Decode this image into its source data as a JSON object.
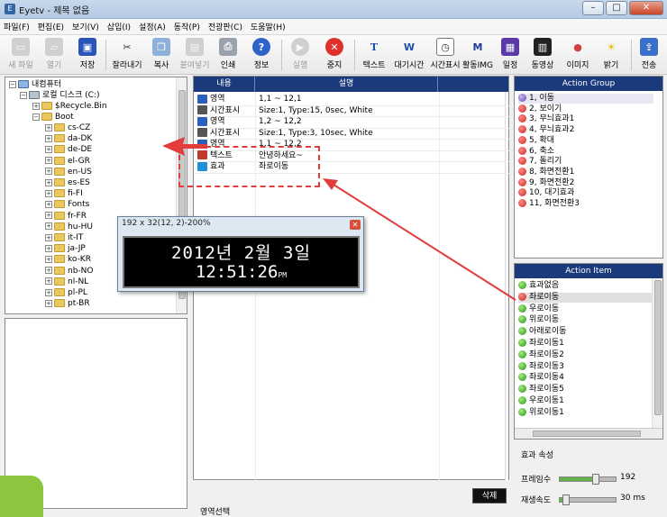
{
  "window": {
    "title": "Eyetv - 제목 없음",
    "controls": [
      "–",
      "□",
      "✕"
    ]
  },
  "menu": [
    "파일(F)",
    "편집(E)",
    "보기(V)",
    "삽입(I)",
    "설정(A)",
    "동작(P)",
    "전광판(C)",
    "도움말(H)"
  ],
  "toolbar": [
    {
      "label": "새 파일",
      "icon": "new-file-icon",
      "enabled": false
    },
    {
      "label": "열기",
      "icon": "open-folder-icon",
      "enabled": false
    },
    {
      "label": "저장",
      "icon": "save-icon",
      "enabled": true
    },
    {
      "label": "잘라내기",
      "icon": "scissors-icon",
      "enabled": true
    },
    {
      "label": "복사",
      "icon": "copy-icon",
      "enabled": true
    },
    {
      "label": "붙여넣기",
      "icon": "paste-icon",
      "enabled": false
    },
    {
      "label": "인쇄",
      "icon": "print-icon",
      "enabled": true
    },
    {
      "label": "정보",
      "icon": "help-icon",
      "enabled": true
    },
    {
      "label": "실행",
      "icon": "play-icon",
      "enabled": false
    },
    {
      "label": "중지",
      "icon": "stop-icon",
      "enabled": true
    },
    {
      "label": "텍스트",
      "icon": "text-tool-icon",
      "enabled": true
    },
    {
      "label": "대기시간",
      "icon": "wait-time-icon",
      "enabled": true
    },
    {
      "label": "시간표시",
      "icon": "clock-display-icon",
      "enabled": true
    },
    {
      "label": "활동IMG",
      "icon": "active-img-icon",
      "enabled": true
    },
    {
      "label": "일정",
      "icon": "schedule-icon",
      "enabled": true
    },
    {
      "label": "동영상",
      "icon": "video-icon",
      "enabled": true
    },
    {
      "label": "이미지",
      "icon": "image-icon",
      "enabled": true
    },
    {
      "label": "밝기",
      "icon": "brightness-icon",
      "enabled": true
    },
    {
      "label": "전송",
      "icon": "transmit-icon",
      "enabled": true
    }
  ],
  "tree": {
    "root": "내컴퓨터",
    "drive": "로컬 디스크 (C:)",
    "items": [
      "$Recycle.Bin",
      "Boot"
    ],
    "boot_children": [
      "cs-CZ",
      "da-DK",
      "de-DE",
      "el-GR",
      "en-US",
      "es-ES",
      "fi-FI",
      "Fonts",
      "fr-FR",
      "hu-HU",
      "it-IT",
      "ja-JP",
      "ko-KR",
      "nb-NO",
      "nl-NL",
      "pl-PL",
      "pt-BR"
    ]
  },
  "grid": {
    "headers": [
      "내용",
      "설명"
    ],
    "rows": [
      {
        "type": "영역",
        "desc": "1,1 ~ 12,1",
        "icon_color": "#2b5fbd"
      },
      {
        "type": "시간표시",
        "desc": "Size:1, Type:15, 0sec, White",
        "icon_color": "#555555"
      },
      {
        "type": "영역",
        "desc": "1,2 ~ 12,2",
        "icon_color": "#2b5fbd"
      },
      {
        "type": "시간표시",
        "desc": "Size:1, Type:3, 10sec, White",
        "icon_color": "#555555"
      },
      {
        "type": "영역",
        "desc": "1,1 ~ 12,2",
        "icon_color": "#2b5fbd"
      },
      {
        "type": "텍스트",
        "desc": "안녕하세요~",
        "icon_color": "#c0392b"
      },
      {
        "type": "효과",
        "desc": "좌로이동",
        "icon_color": "#1f8fd6"
      }
    ],
    "delete_label": "삭제",
    "footer_label": "영역선택"
  },
  "popup": {
    "title": "192 x 32(12, 2)-200%",
    "line1": "2012년  2월  3일",
    "line2": "12:51:26",
    "ampm": "PM"
  },
  "action_group": {
    "title": "Action Group",
    "items": [
      "1, 이동",
      "2, 보이기",
      "3, 무늬효과1",
      "4, 무늬효과2",
      "5, 확대",
      "6, 축소",
      "7, 돌리기",
      "8, 화면전환1",
      "9, 화면전환2",
      "10, 대기효과",
      "11, 화면전환3"
    ]
  },
  "action_item": {
    "title": "Action Item",
    "items": [
      "효과없음",
      "좌로이동",
      "우로이동",
      "위로이동",
      "아래로이동",
      "좌로이동1",
      "좌로이동2",
      "좌로이동3",
      "좌로이동4",
      "좌로이동5",
      "우로이동1",
      "위로이동1"
    ],
    "selected_index": 1
  },
  "effect_props": {
    "title": "효과 속성",
    "frames_label": "프레임수",
    "frames_value": "192",
    "speed_label": "재생속도",
    "speed_value": "30 ms"
  }
}
